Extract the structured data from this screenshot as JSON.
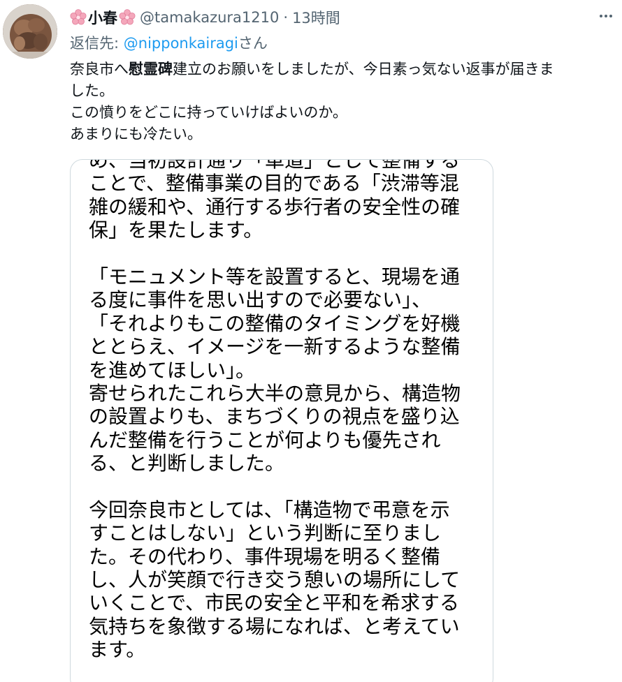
{
  "author": {
    "display_name": "小春",
    "handle": "@tamakazura1210",
    "separator": "·",
    "time": "13時間"
  },
  "reply": {
    "prefix": "返信先: ",
    "mention": "@nipponkairagi",
    "suffix": "さん"
  },
  "tweet": {
    "line1_pre": "奈良市へ",
    "line1_bold": "慰霊碑",
    "line1_post": "建立のお願いをしましたが、今日素っ気ない返事が届きま",
    "line2": "した。",
    "line3": "この憤りをどこに持っていけばよいのか。",
    "line4": "あまりにも冷たい。"
  },
  "image_text": {
    "lines_a": [
      "め、当初設計通り「車道」として整備する",
      "ことで、整備事業の目的である「渋滞等混",
      "雑の緩和や、通行する歩行者の安全性の確",
      "保」を果たします。"
    ],
    "lines_b": [
      "「モニュメント等を設置すると、現場を通",
      "る度に事件を思い出すので必要ない」、",
      "「それよりもこの整備のタイミングを好機",
      "ととらえ、イメージを一新するような整備",
      "を進めてほしい」。",
      "寄せられたこれら大半の意見から、構造物",
      "の設置よりも、まちづくりの視点を盛り込",
      "んだ整備を行うことが何よりも優先され",
      "る、と判断しました。"
    ],
    "lines_c": [
      "今回奈良市としては、「構造物で弔意を示",
      "すことはしない」という判断に至りまし",
      "た。その代わり、事件現場を明るく整備",
      "し、人が笑顔で行き交う憩いの場所にして",
      "いくことで、市民の安全と平和を希求する",
      "気持ちを象徴する場になれば、と考えてい",
      "ます。"
    ]
  },
  "icons": {
    "flower": "cherry-blossom-icon",
    "more": "more-options-icon"
  },
  "colors": {
    "link": "#1d9bf0",
    "secondary": "#536471",
    "border": "#cfd9de",
    "flower": "#f4a7bb"
  }
}
